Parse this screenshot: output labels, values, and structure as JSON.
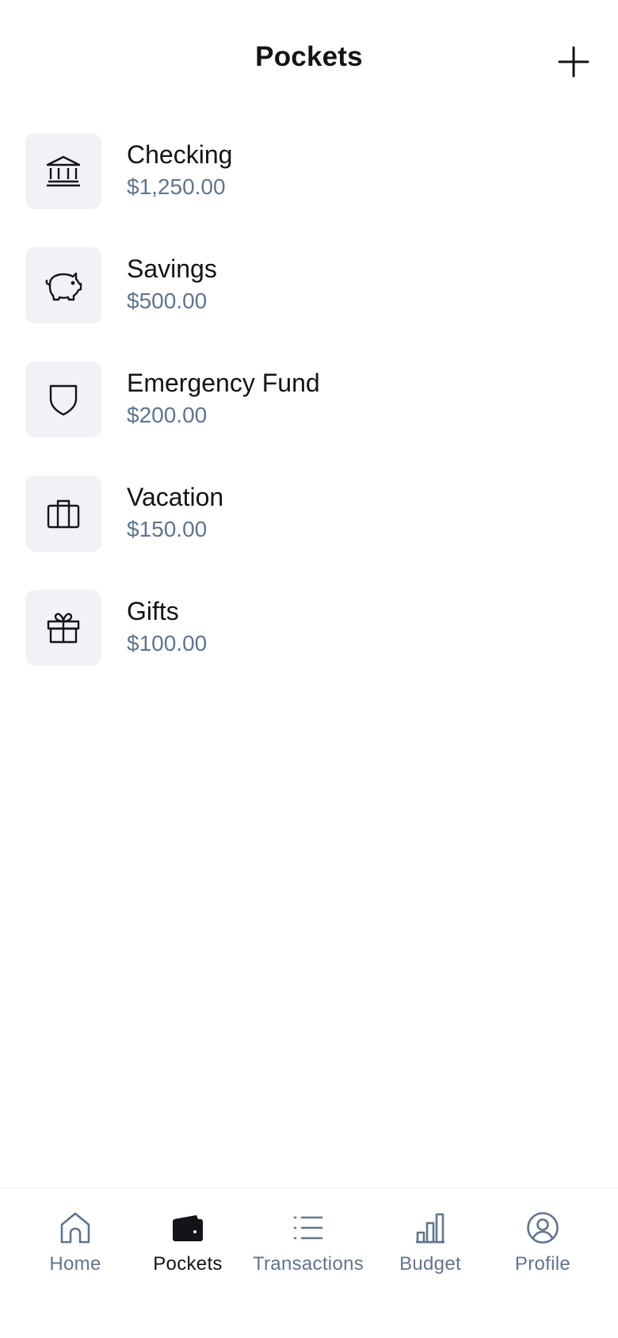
{
  "header": {
    "title": "Pockets",
    "add_icon": "plus-icon"
  },
  "pockets": [
    {
      "name": "Checking",
      "amount": "$1,250.00",
      "icon": "bank-icon"
    },
    {
      "name": "Savings",
      "amount": "$500.00",
      "icon": "piggy-bank-icon"
    },
    {
      "name": "Emergency Fund",
      "amount": "$200.00",
      "icon": "shield-icon"
    },
    {
      "name": "Vacation",
      "amount": "$150.00",
      "icon": "suitcase-icon"
    },
    {
      "name": "Gifts",
      "amount": "$100.00",
      "icon": "gift-icon"
    }
  ],
  "tabbar": {
    "tabs": [
      {
        "label": "Home",
        "icon": "home-icon",
        "active": false
      },
      {
        "label": "Pockets",
        "icon": "wallet-icon",
        "active": true
      },
      {
        "label": "Transactions",
        "icon": "list-icon",
        "active": false
      },
      {
        "label": "Budget",
        "icon": "bar-chart-icon",
        "active": false
      },
      {
        "label": "Profile",
        "icon": "user-circle-icon",
        "active": false
      }
    ]
  },
  "colors": {
    "text_primary": "#121417",
    "text_secondary": "#61758a",
    "icon_bg": "#f0f2f5",
    "divider": "#e8ebee"
  }
}
